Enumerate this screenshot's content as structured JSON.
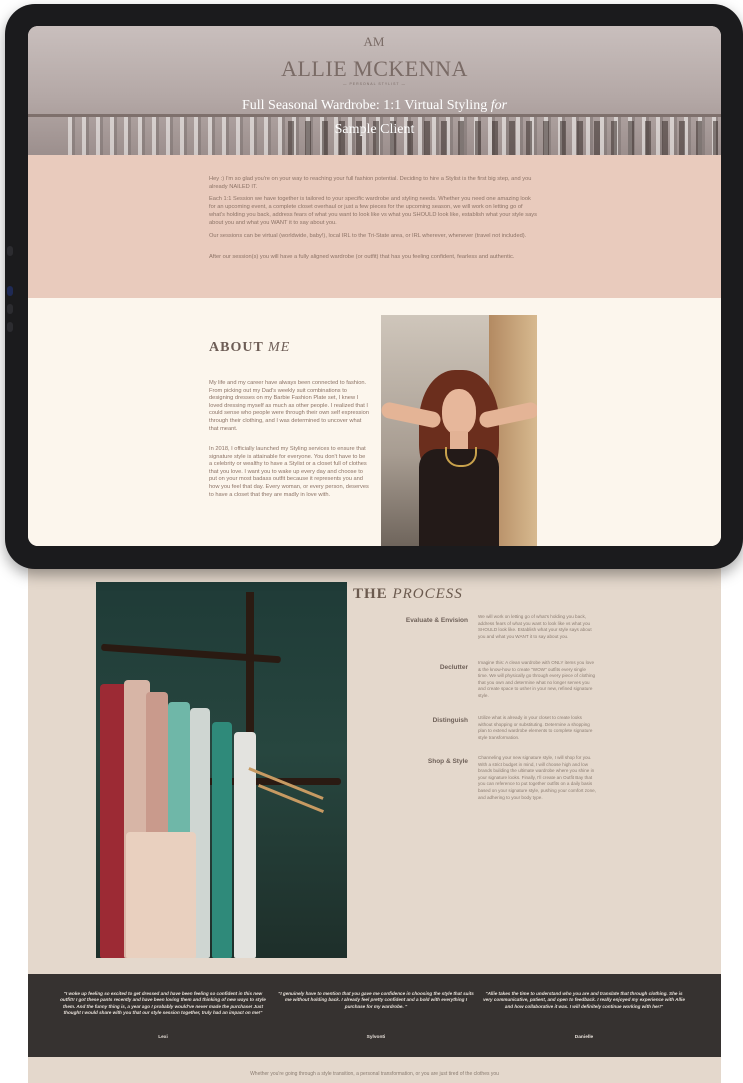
{
  "brand": {
    "monogram": "AM",
    "name": "ALLIE MCKENNA",
    "tagline": "— PERSONAL STYLIST —"
  },
  "hero": {
    "title_main": "Full Seasonal Wardrobe: 1:1 Virtual Styling ",
    "title_italic": "for",
    "title_line2": "Sample Client"
  },
  "intro": {
    "paragraphs": [
      "Hey :) I'm so glad you're on your way to reaching your full fashion potential. Deciding to hire a Stylist is the first big step, and you already NAILED IT.",
      "Each 1:1 Session we have together is tailored to your specific wardrobe and styling needs. Whether you need one amazing look for an upcoming event, a complete closet overhaul or just a few pieces for the upcoming season, we will work on letting go of what's holding you back, address fears of what you want to look like vs what you SHOULD look like, establish what your style says about you and what you WANT it to say about you.",
      "Our sessions can be virtual (worldwide, baby!), local IRL to the Tri-State area, or IRL wherever, whenever (travel not included).",
      "After our session(s) you will have a fully aligned wardrobe (or outfit) that has you feeling confident, fearless and authentic."
    ]
  },
  "about": {
    "title_bold": "ABOUT ",
    "title_italic": "ME",
    "paragraphs": [
      "My life and my career have always been connected to fashion. From picking out my Dad's weekly suit combinations to designing dresses on my Barbie Fashion Plate set, I knew I loved dressing myself as much as other people. I realized that I could sense who people were through their own self expression through their clothing, and I was determined to uncover what that meant.",
      "In 2018, I officially launched my Styling services to ensure that signature style is attainable for everyone. You don't have to be a celebrity or wealthy to have a Stylist or a closet full of clothes that you love. I want you to wake up every day and choose to put on your most badass outfit because it represents you and how you feel that day. Every woman, or every person, deserves to have a closet that they are madly in love with."
    ]
  },
  "process": {
    "title_bold": "THE ",
    "title_italic": "PROCESS",
    "steps": [
      {
        "label": "Evaluate & Envision",
        "text": "We will work on letting go of what's holding you back, address fears of what you want to look like vs what you SHOULD look like. Establish what your style says about you and what you WANT it to say about you."
      },
      {
        "label": "Declutter",
        "text": "Imagine this: A clean wardrobe with ONLY items you love & the know-how to create \"WOW\" outfits every single time. We will physically go through every piece of clothing that you own and determine what no longer serves you and create space to usher in your new, refined signature style."
      },
      {
        "label": "Distinguish",
        "text": "Utilize what is already in your closet to create looks without shopping or substituting. Determine a shopping plan to extend wardrobe elements to complete signature style transformation."
      },
      {
        "label": "Shop & Style",
        "text": "Channeling your new signature style, I will shop for you. With a strict budget in mind, I will choose high and low brands building the ultimate wardrobe where you shine in your signature looks. Finally, I'll create an Outfit Bay that you can reference to put together outfits on a daily basis based on your signature style, pushing your comfort zone, and adhering to your body type."
      }
    ]
  },
  "testimonials": [
    {
      "quote": "\"I woke up feeling so excited to get dressed and have been feeling so confident in this new outfit!! I got these pants recently and have been loving them and thinking of new ways to style them. And the funny thing is, a year ago I probably would've never made the purchase! Just thought I would share with you that our style session together, truly had an impact on me!\"",
      "name": "Lexi"
    },
    {
      "quote": "\"I genuinely have to mention that you gave me confidence in choosing the style that suits me without holding back. I already feel pretty confident and a bold with everything I purchase for my wardrobe. \"",
      "name": "Sylvonti"
    },
    {
      "quote": "\"Allie takes the time to understand who you are and translate that through clothing. She is very communicative, patient, and open to feedback. I really enjoyed my experience with Allie and how collaborative it was. I will definitely continue working with her!\"",
      "name": "Danielle"
    }
  ],
  "closing": {
    "text": "Whether you're going through a style transition, a personal transformation, or you are just tired of the clothes you"
  }
}
